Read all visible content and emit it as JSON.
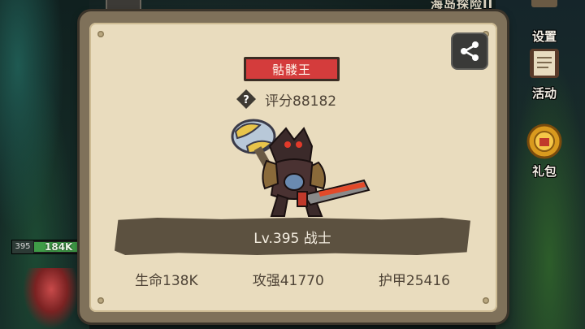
{
  "background": {
    "top_label": "海岛探险II",
    "side_menu": [
      {
        "label": "设置",
        "icon": "gear-icon"
      },
      {
        "label": "活动",
        "icon": "scroll-icon"
      },
      {
        "label": "礼包",
        "icon": "gift-pot-icon"
      }
    ],
    "hp_bar": {
      "level": "395",
      "hp": "184K",
      "fill": 0.85
    }
  },
  "dialog": {
    "name": "骷髅王",
    "score": "评分88182",
    "level_class": "Lv.395 战士",
    "stats": {
      "hp": "生命138K",
      "attack": "攻强41770",
      "armor": "护甲25416"
    }
  },
  "colors": {
    "panel": "#e9dcbe",
    "frame": "#7f715a",
    "banner_red": "#d43c3c",
    "level_bar": "#5c5140",
    "text_brown": "#4e4336"
  }
}
